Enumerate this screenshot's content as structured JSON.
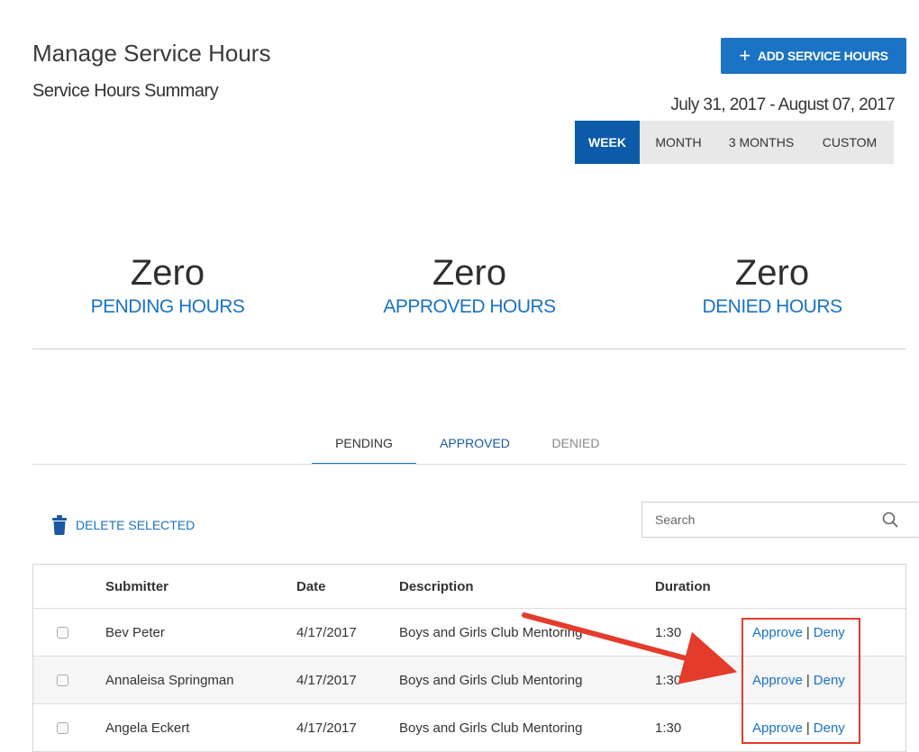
{
  "page": {
    "title": "Manage Service Hours",
    "subtitle": "Service Hours Summary",
    "add_button_label": "ADD SERVICE HOURS",
    "date_range": "July 31, 2017 - August 07, 2017"
  },
  "range_tabs": [
    {
      "label": "WEEK",
      "active": true
    },
    {
      "label": "MONTH",
      "active": false
    },
    {
      "label": "3 MONTHS",
      "active": false
    },
    {
      "label": "CUSTOM",
      "active": false
    }
  ],
  "stats": [
    {
      "value": "Zero",
      "label": "PENDING HOURS"
    },
    {
      "value": "Zero",
      "label": "APPROVED HOURS"
    },
    {
      "value": "Zero",
      "label": "DENIED HOURS"
    }
  ],
  "status_tabs": [
    {
      "label": "PENDING",
      "active": true
    },
    {
      "label": "APPROVED",
      "active": false
    },
    {
      "label": "DENIED",
      "active": false
    }
  ],
  "toolbar": {
    "delete_label": "DELETE SELECTED",
    "search_placeholder": "Search"
  },
  "table": {
    "columns": [
      "Submitter",
      "Date",
      "Description",
      "Duration"
    ],
    "rows": [
      {
        "submitter": "Bev Peter",
        "date": "4/17/2017",
        "description": "Boys and Girls Club Mentoring",
        "duration": "1:30",
        "approve": "Approve",
        "deny": "Deny"
      },
      {
        "submitter": "Annaleisa Springman",
        "date": "4/17/2017",
        "description": "Boys and Girls Club Mentoring",
        "duration": "1:30",
        "approve": "Approve",
        "deny": "Deny"
      },
      {
        "submitter": "Angela Eckert",
        "date": "4/17/2017",
        "description": "Boys and Girls Club Mentoring",
        "duration": "1:30",
        "approve": "Approve",
        "deny": "Deny"
      }
    ],
    "action_separator": "|"
  },
  "colors": {
    "accent": "#1a73c4",
    "active_tab": "#0b5ba8",
    "highlight": "#e33b2c"
  }
}
